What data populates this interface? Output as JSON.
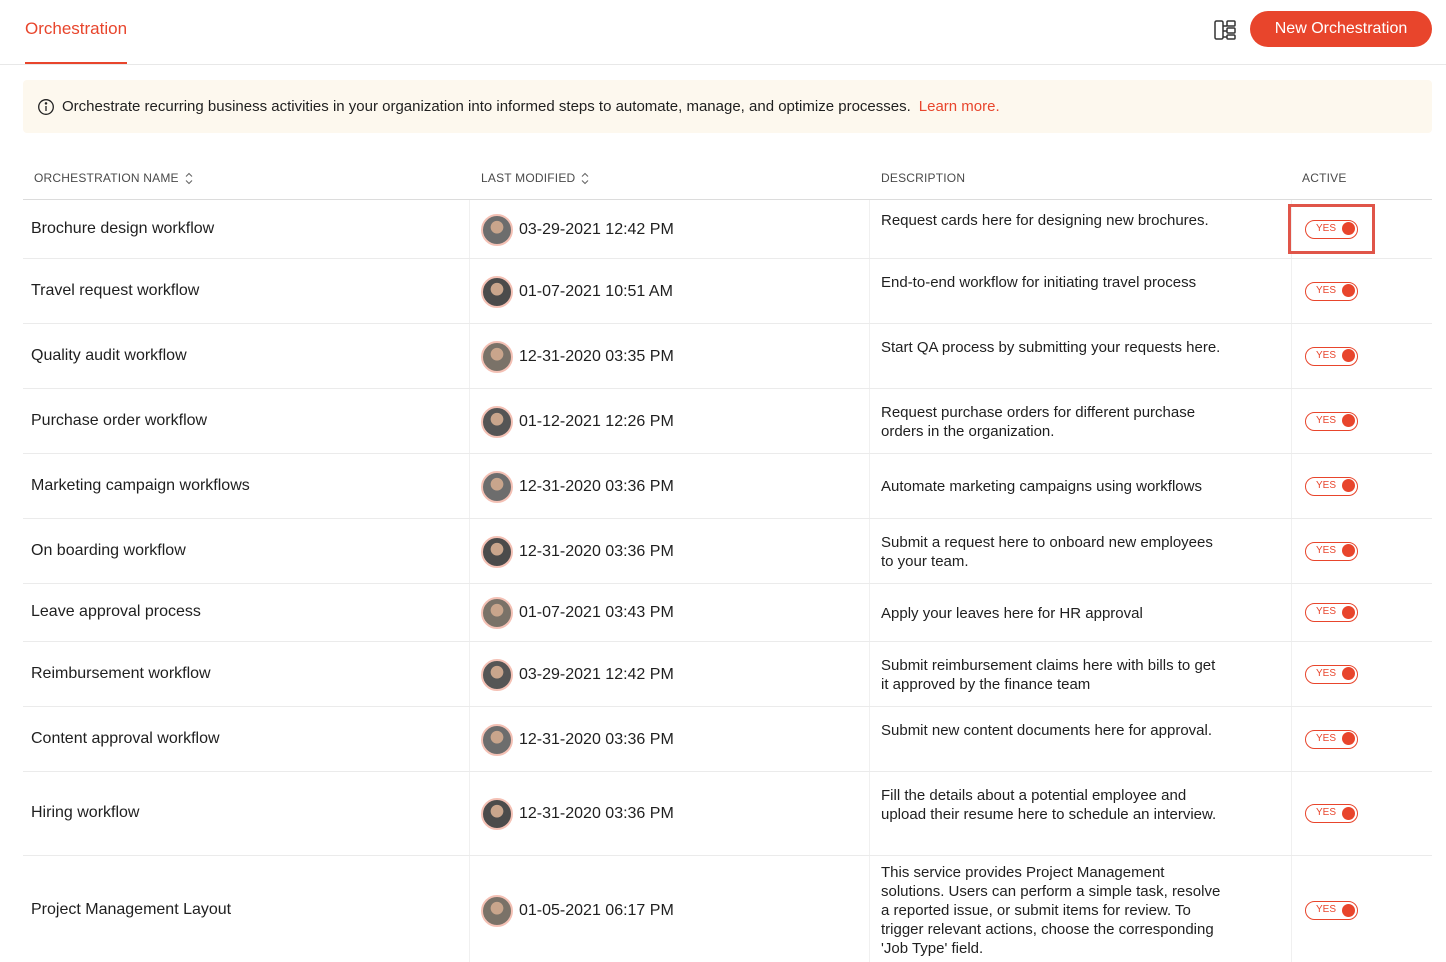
{
  "header": {
    "tab_label": "Orchestration",
    "new_button_label": "New Orchestration"
  },
  "banner": {
    "text": "Orchestrate recurring business activities in your organization into informed steps to automate, manage, and optimize processes.",
    "link": "Learn more."
  },
  "table": {
    "columns": [
      "ORCHESTRATION NAME",
      "LAST MODIFIED",
      "DESCRIPTION",
      "ACTIVE"
    ],
    "rows": [
      {
        "name": "Brochure design workflow",
        "modified": "03-29-2021 12:42 PM",
        "description": "Request cards here for designing new brochures.",
        "active": "YES"
      },
      {
        "name": "Travel request workflow",
        "modified": "01-07-2021 10:51 AM",
        "description": "End-to-end workflow for initiating travel process",
        "active": "YES"
      },
      {
        "name": "Quality audit workflow",
        "modified": "12-31-2020 03:35 PM",
        "description": "Start QA process by submitting your requests here.",
        "active": "YES"
      },
      {
        "name": "Purchase order workflow",
        "modified": "01-12-2021 12:26 PM",
        "description": "Request purchase orders for different purchase orders in the organization.",
        "active": "YES"
      },
      {
        "name": "Marketing campaign workflows",
        "modified": "12-31-2020 03:36 PM",
        "description": "Automate marketing campaigns using workflows",
        "active": "YES"
      },
      {
        "name": "On boarding workflow",
        "modified": "12-31-2020 03:36 PM",
        "description": "Submit a request here to onboard new employees to your team.",
        "active": "YES"
      },
      {
        "name": "Leave approval process",
        "modified": "01-07-2021 03:43 PM",
        "description": "Apply your leaves here for HR approval",
        "active": "YES"
      },
      {
        "name": "Reimbursement workflow",
        "modified": "03-29-2021 12:42 PM",
        "description": "Submit reimbursement claims here with bills to get it approved by the finance team",
        "active": "YES"
      },
      {
        "name": "Content approval workflow",
        "modified": "12-31-2020 03:36 PM",
        "description": "Submit new content documents here for approval.",
        "active": "YES"
      },
      {
        "name": "Hiring workflow",
        "modified": "12-31-2020 03:36 PM",
        "description": "Fill the details about a potential employee and upload their resume here to schedule an interview.",
        "active": "YES"
      },
      {
        "name": "Project Management Layout",
        "modified": "01-05-2021 06:17 PM",
        "description": "This service provides Project Management solutions. Users can perform a simple task, resolve a reported issue, or submit items for review. To trigger relevant actions, choose the corresponding 'Job Type' field.",
        "active": "YES"
      }
    ]
  },
  "colors": {
    "accent": "#e8452c",
    "banner_bg": "#fdf8ee",
    "highlight_box": "#e05549"
  }
}
